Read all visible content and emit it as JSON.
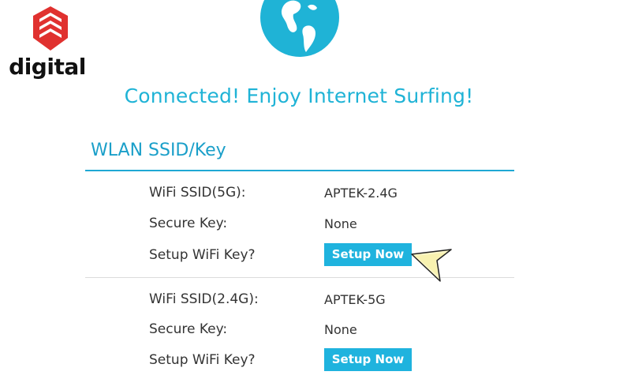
{
  "logo": {
    "text": "digital"
  },
  "header": {
    "message": "Connected! Enjoy Internet Surfing!"
  },
  "wlan": {
    "title": "WLAN SSID/Key",
    "networks": [
      {
        "ssid_label": "WiFi SSID(5G):",
        "ssid_value": "APTEK-2.4G",
        "key_label": "Secure Key:",
        "key_value": "None",
        "setup_label": "Setup WiFi Key?",
        "setup_button": "Setup Now"
      },
      {
        "ssid_label": "WiFi SSID(2.4G):",
        "ssid_value": "APTEK-5G",
        "key_label": "Secure Key:",
        "key_value": "None",
        "setup_label": "Setup WiFi Key?",
        "setup_button": "Setup Now"
      }
    ]
  },
  "colors": {
    "accent": "#1fb3d6",
    "button": "#1fb3de",
    "logo_red": "#e0312f"
  },
  "icons": {
    "logo": "digital-logo-icon",
    "globe": "globe-icon",
    "cursor": "pointer-cursor-icon"
  }
}
